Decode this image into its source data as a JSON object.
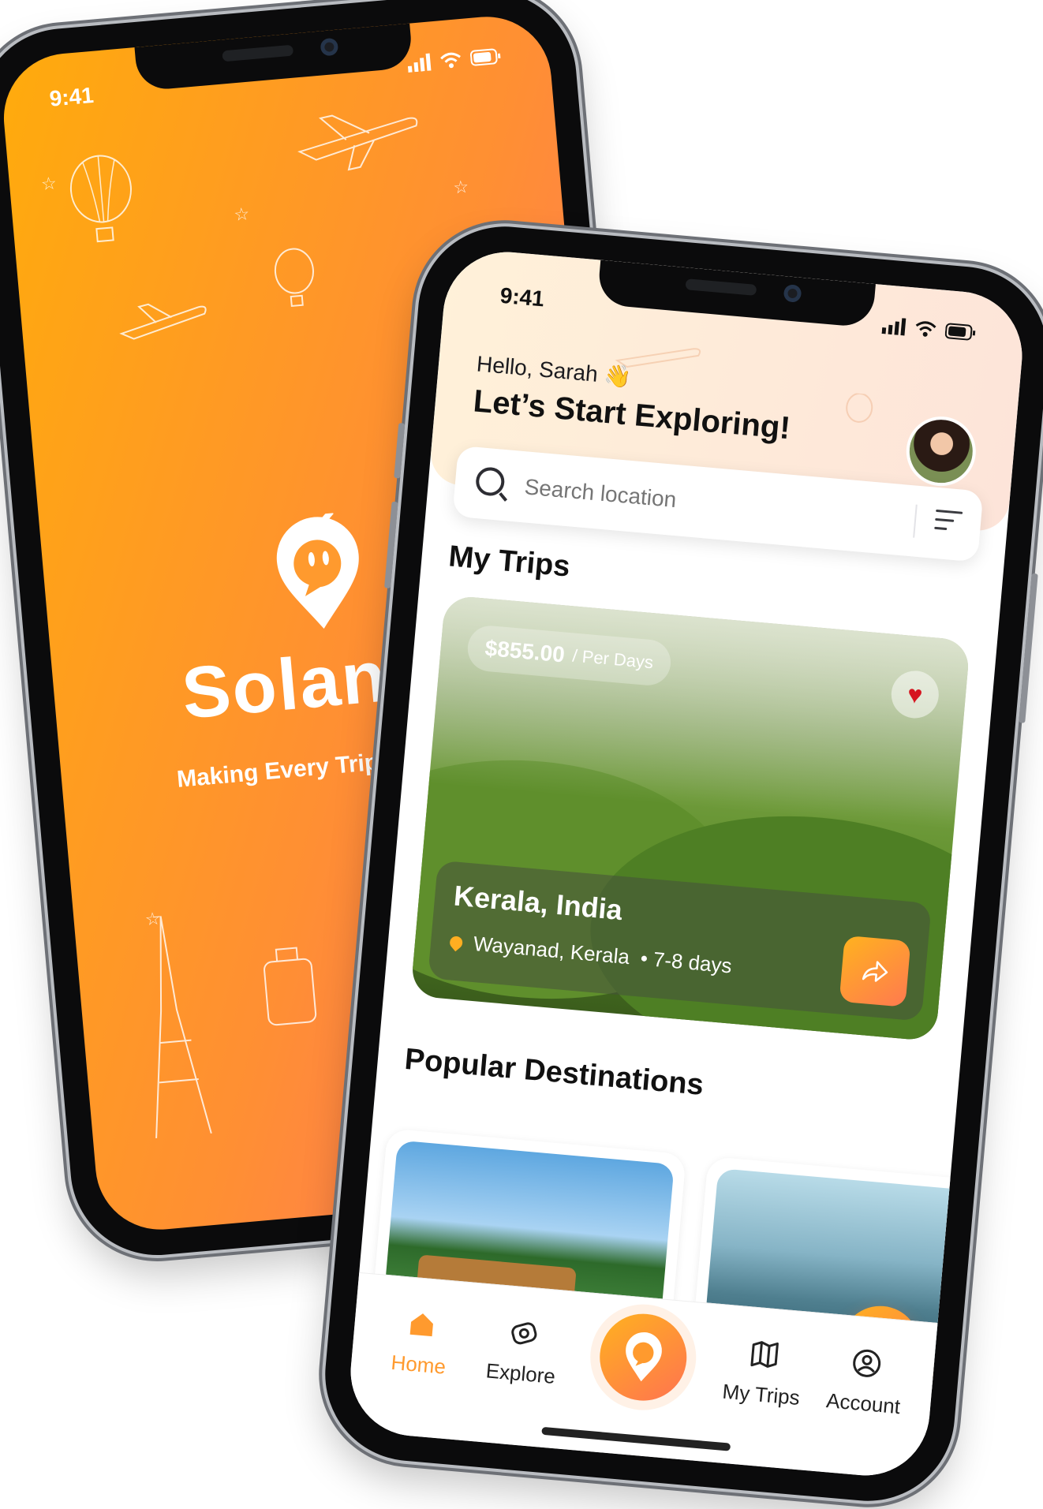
{
  "status_time": "9:41",
  "splash": {
    "brand": "Solange",
    "tagline": "Making Every Trip a Tailored"
  },
  "app": {
    "greeting": "Hello, Sarah 👋",
    "headline": "Let’s Start Exploring!",
    "search_placeholder": "Search location",
    "my_trips_title": "My Trips",
    "trip": {
      "price": "$855.00",
      "price_unit": "/ Per Days",
      "name": "Kerala, India",
      "location": "Wayanad, Kerala",
      "duration": "• 7-8 days"
    },
    "popular_title": "Popular Destinations",
    "tabs": {
      "home": "Home",
      "explore": "Explore",
      "my_trips": "My Trips",
      "account": "Account"
    }
  },
  "colors": {
    "accent": "#ff9a2e",
    "gradient_start": "#ffab0c",
    "gradient_end": "#ff7166",
    "heart": "#d6141f"
  },
  "icons": [
    "signal-icon",
    "wifi-icon",
    "battery-icon",
    "search-icon",
    "filter-icon",
    "heart-icon",
    "location-pin-icon",
    "share-icon",
    "plus-icon",
    "home-icon",
    "explore-icon",
    "map-icon",
    "account-icon",
    "logo-icon"
  ]
}
